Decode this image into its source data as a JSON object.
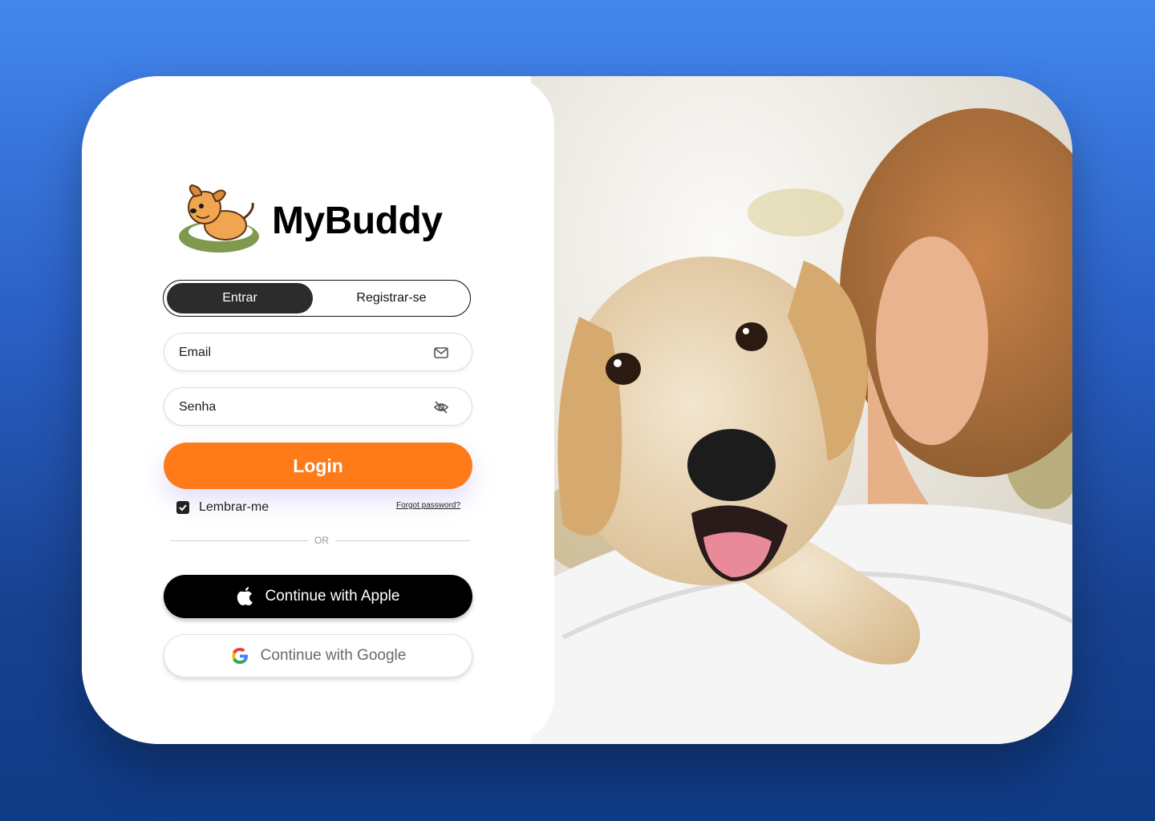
{
  "brand": {
    "name": "MyBuddy",
    "logo": "dog-mascot-logo"
  },
  "tabs": [
    {
      "label": "Entrar",
      "active": true
    },
    {
      "label": "Registrar-se",
      "active": false
    }
  ],
  "form": {
    "email": {
      "placeholder": "Email",
      "icon": "mail-icon"
    },
    "password": {
      "placeholder": "Senha",
      "icon": "eye-off-icon"
    },
    "login_label": "Login",
    "remember_label": "Lembrar-me",
    "remember_checked": true,
    "forgot_label": "Forgot password?",
    "divider_label": "OR"
  },
  "social": {
    "apple_label": "Continue with Apple",
    "google_label": "Continue with Google"
  },
  "photo": {
    "subject": "puppy-hugging-person-image"
  },
  "colors": {
    "background_top": "#4387ee",
    "background_bottom": "#0f3a84",
    "accent": "#ff7a18",
    "tab_active": "#2c2c2c"
  }
}
